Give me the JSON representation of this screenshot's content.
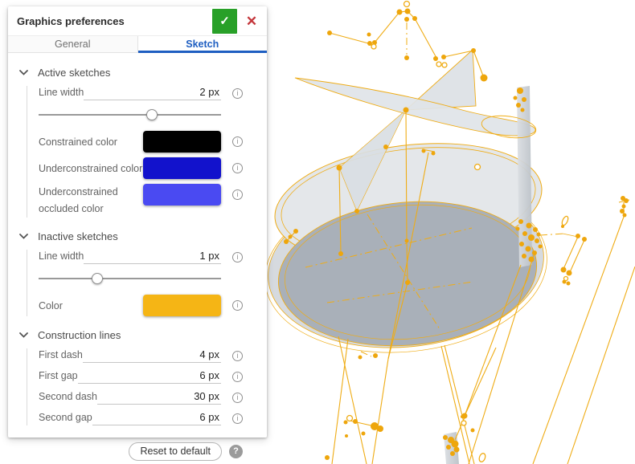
{
  "dialog": {
    "title": "Graphics preferences",
    "actions": {
      "confirm_glyph": "✓",
      "close_glyph": "✕"
    },
    "tabs": [
      {
        "label": "General",
        "active": false
      },
      {
        "label": "Sketch",
        "active": true
      }
    ],
    "sections": {
      "active": {
        "title": "Active sketches",
        "line_width": {
          "label": "Line width",
          "value": "2 px",
          "slider_pct": 62
        },
        "constrained": {
          "label": "Constrained color",
          "color": "#000000"
        },
        "underconstrained": {
          "label": "Underconstrained color",
          "color": "#1212CC"
        },
        "occluded": {
          "label": "Underconstrained occluded color",
          "color": "#4A4AF2"
        }
      },
      "inactive": {
        "title": "Inactive sketches",
        "line_width": {
          "label": "Line width",
          "value": "1 px",
          "slider_pct": 32
        },
        "color": {
          "label": "Color",
          "color": "#F5B515"
        }
      },
      "construction": {
        "title": "Construction lines",
        "rows": [
          {
            "label": "First dash",
            "value": "4 px"
          },
          {
            "label": "First gap",
            "value": "6 px"
          },
          {
            "label": "Second dash",
            "value": "30 px"
          },
          {
            "label": "Second gap",
            "value": "6 px"
          }
        ]
      }
    },
    "footer": {
      "reset_label": "Reset to default",
      "help_glyph": "?"
    }
  },
  "viewport": {
    "sketch_line_color": "#EFAC15",
    "sketch_point_color": "#EEA60C",
    "surface_top_color": "#E4E7EA",
    "surface_inner_color": "#A9B0B9",
    "surface_rim_color": "#D6DADF"
  }
}
